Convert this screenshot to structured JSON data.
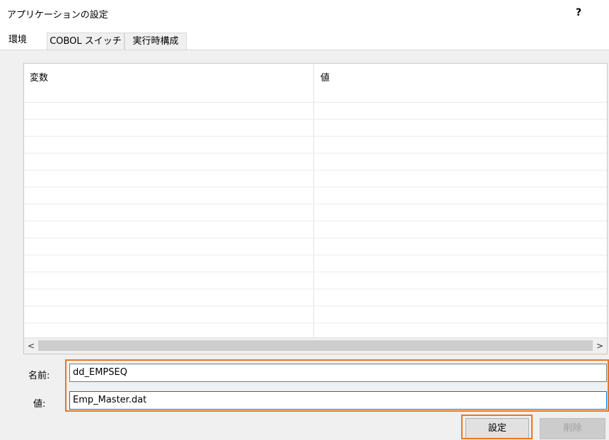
{
  "window": {
    "title": "アプリケーションの設定",
    "help": "?"
  },
  "tabs": [
    {
      "label": "環境",
      "active": true
    },
    {
      "label": "COBOL スイッチ",
      "active": false
    },
    {
      "label": "実行時構成",
      "active": false
    }
  ],
  "grid": {
    "columns": [
      "変数",
      "値"
    ],
    "rows": []
  },
  "scroll": {
    "left_icon": "chevron-left-icon",
    "right_icon": "chevron-right-icon",
    "left_glyph": "<",
    "right_glyph": ">"
  },
  "form": {
    "name_label": "名前:",
    "name_value": "dd_EMPSEQ",
    "value_label": "値:",
    "value_value": "Emp_Master.dat"
  },
  "buttons": {
    "set": "設定",
    "delete": "削除"
  },
  "colors": {
    "highlight": "#e87722",
    "focus": "#0078d7",
    "panel": "#f0f0f0"
  }
}
